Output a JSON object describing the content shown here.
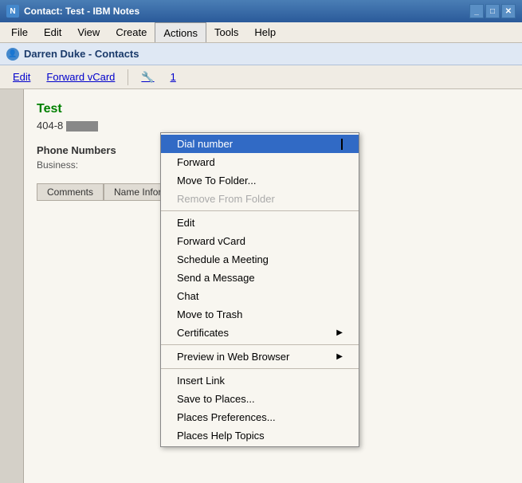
{
  "window": {
    "title": "Contact: Test - IBM Notes",
    "icon": "notes-icon"
  },
  "menubar": {
    "items": [
      {
        "label": "File",
        "id": "file"
      },
      {
        "label": "Edit",
        "id": "edit"
      },
      {
        "label": "View",
        "id": "view"
      },
      {
        "label": "Create",
        "id": "create"
      },
      {
        "label": "Actions",
        "id": "actions",
        "active": true
      },
      {
        "label": "Tools",
        "id": "tools"
      },
      {
        "label": "Help",
        "id": "help"
      }
    ]
  },
  "contact_header": {
    "label": "Darren Duke - Contacts"
  },
  "toolbar": {
    "edit_label": "Edit",
    "forward_vcard_label": "Forward vCard"
  },
  "contact": {
    "name": "Test",
    "phone": "404-8",
    "phone_sections": {
      "title": "Phone Numbers",
      "business_label": "Business:"
    }
  },
  "tabs": [
    {
      "label": "Comments",
      "active": false
    },
    {
      "label": "Name Infor",
      "active": false
    }
  ],
  "actions_menu": {
    "items": [
      {
        "label": "Dial number",
        "id": "dial-number",
        "highlighted": true,
        "has_arrow": false,
        "disabled": false
      },
      {
        "label": "Forward",
        "id": "forward",
        "highlighted": false,
        "has_arrow": false,
        "disabled": false
      },
      {
        "label": "Move To Folder...",
        "id": "move-to-folder",
        "highlighted": false,
        "has_arrow": false,
        "disabled": false
      },
      {
        "label": "Remove From Folder",
        "id": "remove-from-folder",
        "highlighted": false,
        "has_arrow": false,
        "disabled": true
      },
      {
        "separator": true
      },
      {
        "label": "Edit",
        "id": "edit",
        "highlighted": false,
        "has_arrow": false,
        "disabled": false
      },
      {
        "label": "Forward vCard",
        "id": "forward-vcard",
        "highlighted": false,
        "has_arrow": false,
        "disabled": false
      },
      {
        "label": "Schedule a Meeting",
        "id": "schedule-meeting",
        "highlighted": false,
        "has_arrow": false,
        "disabled": false
      },
      {
        "label": "Send a Message",
        "id": "send-message",
        "highlighted": false,
        "has_arrow": false,
        "disabled": false
      },
      {
        "label": "Chat",
        "id": "chat",
        "highlighted": false,
        "has_arrow": false,
        "disabled": false
      },
      {
        "label": "Move to Trash",
        "id": "move-to-trash",
        "highlighted": false,
        "has_arrow": false,
        "disabled": false
      },
      {
        "label": "Certificates",
        "id": "certificates",
        "highlighted": false,
        "has_arrow": true,
        "disabled": false
      },
      {
        "separator": true
      },
      {
        "label": "Preview in Web Browser",
        "id": "preview-web-browser",
        "highlighted": false,
        "has_arrow": true,
        "disabled": false
      },
      {
        "separator": true
      },
      {
        "label": "Insert Link",
        "id": "insert-link",
        "highlighted": false,
        "has_arrow": false,
        "disabled": false
      },
      {
        "label": "Save to Places...",
        "id": "save-to-places",
        "highlighted": false,
        "has_arrow": false,
        "disabled": false
      },
      {
        "label": "Places Preferences...",
        "id": "places-preferences",
        "highlighted": false,
        "has_arrow": false,
        "disabled": false
      },
      {
        "label": "Places Help Topics",
        "id": "places-help-topics",
        "highlighted": false,
        "has_arrow": false,
        "disabled": false
      }
    ]
  },
  "colors": {
    "accent": "#316ac5",
    "highlight_bg": "#316ac5",
    "highlight_text": "#ffffff",
    "contact_name": "#008000"
  }
}
